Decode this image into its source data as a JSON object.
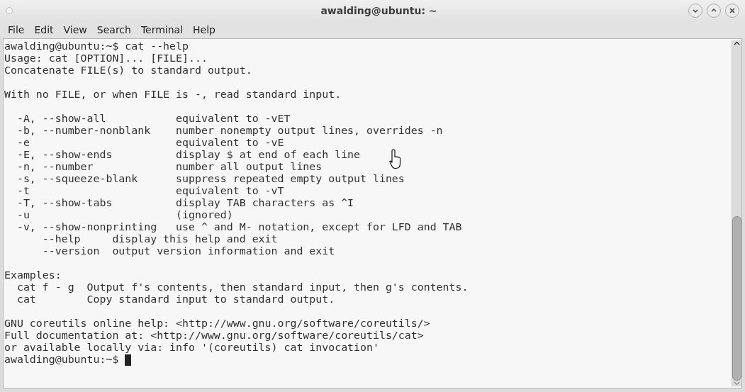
{
  "window": {
    "title": "awalding@ubuntu: ~"
  },
  "menu": [
    "File",
    "Edit",
    "View",
    "Search",
    "Terminal",
    "Help"
  ],
  "terminal": {
    "lines": [
      {
        "kind": "text",
        "text": "awalding@ubuntu:~$ cat --help"
      },
      {
        "kind": "text",
        "text": "Usage: cat [OPTION]... [FILE]..."
      },
      {
        "kind": "text",
        "text": "Concatenate FILE(s) to standard output."
      },
      {
        "kind": "blank"
      },
      {
        "kind": "text",
        "text": "With no FILE, or when FILE is -, read standard input."
      },
      {
        "kind": "blank"
      },
      {
        "kind": "text",
        "text": "  -A, --show-all           equivalent to -vET"
      },
      {
        "kind": "text",
        "text": "  -b, --number-nonblank    number nonempty output lines, overrides -n"
      },
      {
        "kind": "text",
        "text": "  -e                       equivalent to -vE"
      },
      {
        "kind": "text",
        "text": "  -E, --show-ends          display $ at end of each line"
      },
      {
        "kind": "text",
        "text": "  -n, --number             number all output lines"
      },
      {
        "kind": "text",
        "text": "  -s, --squeeze-blank      suppress repeated empty output lines"
      },
      {
        "kind": "text",
        "text": "  -t                       equivalent to -vT"
      },
      {
        "kind": "text",
        "text": "  -T, --show-tabs          display TAB characters as ^I"
      },
      {
        "kind": "text",
        "text": "  -u                       (ignored)"
      },
      {
        "kind": "text",
        "text": "  -v, --show-nonprinting   use ^ and M- notation, except for LFD and TAB"
      },
      {
        "kind": "text",
        "text": "      --help     display this help and exit"
      },
      {
        "kind": "text",
        "text": "      --version  output version information and exit"
      },
      {
        "kind": "blank"
      },
      {
        "kind": "text",
        "text": "Examples:"
      },
      {
        "kind": "text",
        "text": "  cat f - g  Output f's contents, then standard input, then g's contents."
      },
      {
        "kind": "text",
        "text": "  cat        Copy standard input to standard output."
      },
      {
        "kind": "blank"
      },
      {
        "kind": "text",
        "text": "GNU coreutils online help: <http://www.gnu.org/software/coreutils/>"
      },
      {
        "kind": "text",
        "text": "Full documentation at: <http://www.gnu.org/software/coreutils/cat>"
      },
      {
        "kind": "text",
        "text": "or available locally via: info '(coreutils) cat invocation'"
      },
      {
        "kind": "prompt",
        "text": "awalding@ubuntu:~$"
      }
    ]
  }
}
